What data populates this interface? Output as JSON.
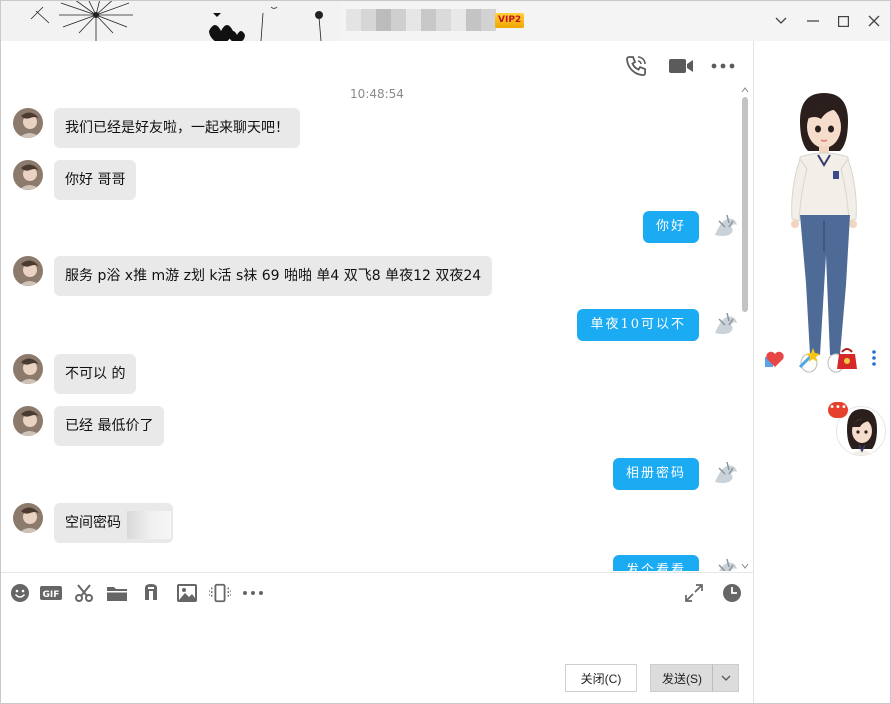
{
  "titlebar": {
    "vip_badge": "VIP2",
    "controls": [
      "minimize-dropdown",
      "minimize",
      "maximize",
      "close"
    ]
  },
  "toolbar": {
    "icons": [
      "phone-call-icon",
      "video-call-icon",
      "more-icon"
    ]
  },
  "chat": {
    "timestamp": "10:48:54",
    "messages": [
      {
        "side": "in",
        "text": "我们已经是好友啦，一起来聊天吧！"
      },
      {
        "side": "in",
        "text": "你好  哥哥"
      },
      {
        "side": "out",
        "text": "你好"
      },
      {
        "side": "in",
        "text": "服务 p浴  x推  m游  z划  k活  s袜  69 啪啪 单4 双飞8  单夜12 双夜24"
      },
      {
        "side": "out",
        "text": "单夜10可以不"
      },
      {
        "side": "in",
        "text": "不可以 的"
      },
      {
        "side": "in",
        "text": "已经 最低价了"
      },
      {
        "side": "out",
        "text": "相册密码"
      },
      {
        "side": "in",
        "text": "空间密码"
      },
      {
        "side": "out",
        "text": "发个看看"
      }
    ]
  },
  "input_toolbar": {
    "icons": [
      "emoji-icon",
      "gif-icon",
      "screenshot-scissors-icon",
      "folder-icon",
      "music-icon",
      "image-icon",
      "shake-icon",
      "more-dots-icon",
      "expand-icon",
      "history-clock-icon"
    ]
  },
  "actions": {
    "close_label": "关闭(C)",
    "send_label": "发送(S)"
  },
  "right_panel": {
    "show_icons": [
      "gift-heart-icon",
      "magic-wand-icon",
      "red-bag-icon",
      "vertical-more-icon"
    ]
  },
  "colors": {
    "outgoing_bubble": "#1aabf2",
    "incoming_bubble": "#e9e9e9",
    "titlebar": "#f4f4f4"
  }
}
